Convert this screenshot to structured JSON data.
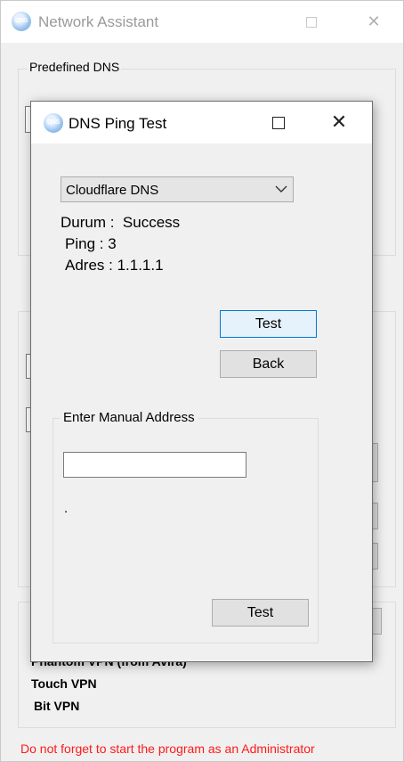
{
  "main_window": {
    "title": "Network Assistant",
    "app_icon_text": "DNS",
    "predefined_group_label": "Predefined DNS",
    "vpn_items": [
      "Phantom VPN (from Avira)",
      "Touch VPN",
      "Bit VPN"
    ],
    "admin_notice": "Do not forget to start the program as an Administrator"
  },
  "dialog": {
    "title": "DNS Ping Test",
    "icon_text": "DNS",
    "dns_select": {
      "selected": "Cloudflare DNS"
    },
    "status": {
      "durum": "Durum :  Success",
      "ping": "Ping : 3",
      "adres": "Adres : 1.1.1.1"
    },
    "test_button": "Test",
    "back_button": "Back",
    "manual_group": {
      "label": "Enter Manual Address",
      "input_value": "",
      "status_text": ".",
      "test_button": "Test"
    }
  },
  "colors": {
    "window_bg": "#f0f0f0",
    "titlebar_bg": "#ffffff",
    "focus_border": "#0078d7",
    "focus_fill": "#e5f1fb",
    "admin_notice": "#ff1a1a"
  }
}
